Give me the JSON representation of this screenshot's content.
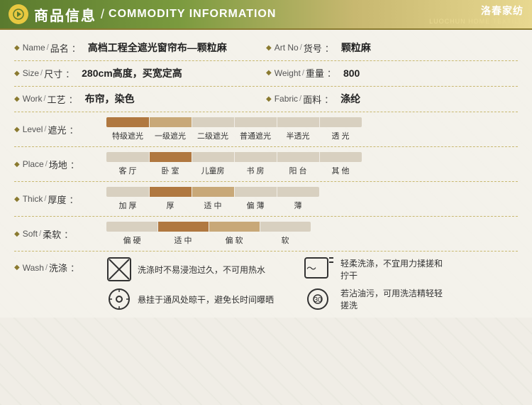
{
  "header": {
    "icon_arrow": "▶",
    "title_cn": "商品信息",
    "slash": "/",
    "title_en": "COMMODITY INFORMATION",
    "logo_cn": "洛春家纺",
    "logo_en": "LUOCHUN HOME TEXTILE"
  },
  "fields": {
    "name_en": "Name",
    "name_slash": "/",
    "name_cn": "品名",
    "name_colon": "：",
    "name_value": "高档工程全遮光窗帘布—颗粒麻",
    "artno_en": "Art No",
    "artno_slash": "/",
    "artno_cn": "货号",
    "artno_colon": "：",
    "artno_value": "颗粒麻",
    "size_en": "Size",
    "size_slash": "/",
    "size_cn": "尺寸",
    "size_colon": "：",
    "size_value": "280cm高度，买宽定高",
    "weight_en": "Weight",
    "weight_slash": "/",
    "weight_cn": "重量",
    "weight_colon": "：",
    "weight_value": "800",
    "work_en": "Work",
    "work_slash": "/",
    "work_cn": "工艺",
    "work_colon": "：",
    "work_value": "布帘，染色",
    "fabric_en": "Fabric",
    "fabric_slash": "/",
    "fabric_cn": "面料",
    "fabric_colon": "：",
    "fabric_value": "涤纶",
    "level_en": "Level",
    "level_slash": "/",
    "level_cn": "遮光",
    "level_colon": "：",
    "level_labels": [
      "特级遮光",
      "一级遮光",
      "二级遮光",
      "普通遮光",
      "半透光",
      "透 光"
    ],
    "place_en": "Place",
    "place_slash": "/",
    "place_cn": "场地",
    "place_colon": "：",
    "place_labels": [
      "客 厅",
      "卧 室",
      "儿童房",
      "书 房",
      "阳 台",
      "其 他"
    ],
    "thick_en": "Thick",
    "thick_slash": "/",
    "thick_cn": "厚度",
    "thick_colon": "：",
    "thick_labels": [
      "加 厚",
      "厚",
      "适 中",
      "偏 薄",
      "薄"
    ],
    "soft_en": "Soft",
    "soft_slash": "/",
    "soft_cn": "柔软",
    "soft_colon": "：",
    "soft_labels": [
      "偏 硬",
      "适 中",
      "偏 软",
      "软"
    ],
    "wash_en": "Wash",
    "wash_slash": "/",
    "wash_cn": "洗涤",
    "wash_colon": "：",
    "wash_text1": "洗涤时不易浸泡过久，不可用热水",
    "wash_text2": "轻柔洗涤，不宜用力揉搓和拧干",
    "wash_text3": "悬挂于通风处晾干，避免长时间曝晒",
    "wash_text4": "若沾油污，可用洗洁精轻轻搓洗"
  },
  "colors": {
    "accent": "#8a7a30",
    "header_start": "#5a7a2e",
    "bar_active": "#c8a878",
    "bar_inactive": "#d8d0c0",
    "bar_highlight": "#b07840"
  }
}
